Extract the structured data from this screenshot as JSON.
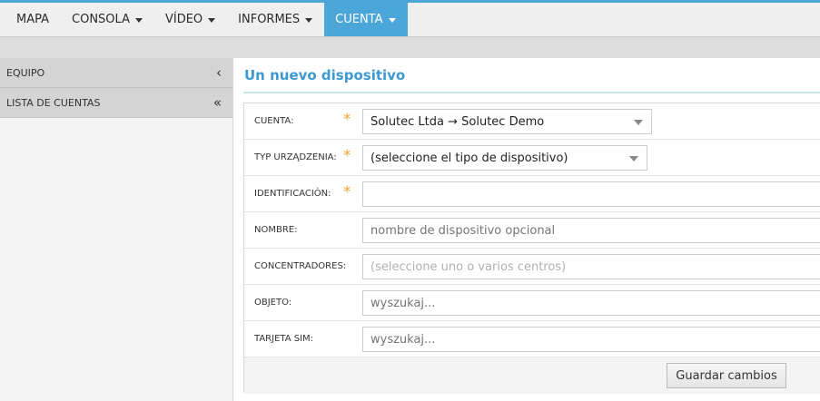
{
  "nav": {
    "items": [
      {
        "label": "MAPA"
      },
      {
        "label": "CONSOLA"
      },
      {
        "label": "VÍDEO"
      },
      {
        "label": "INFORMES"
      },
      {
        "label": "CUENTA"
      }
    ],
    "active": "CUENTA",
    "accent_color": "#4ba7d9"
  },
  "sidebar": {
    "items": [
      {
        "label": "EQUIPO",
        "icon": "chevron-left-icon"
      },
      {
        "label": "LISTA DE CUENTAS",
        "icon": "double-chevron-left-icon"
      }
    ]
  },
  "main": {
    "title": "Un nuevo dispositivo",
    "title_color": "#3d9ad0"
  },
  "form": {
    "account": {
      "label": "CUENTA:",
      "value": "Solutec Ltda → Solutec Demo",
      "required": true
    },
    "device_type": {
      "label": "TYP URZĄDZENIA:",
      "value": "(seleccione el tipo de dispositivo)",
      "required": true
    },
    "identification": {
      "label": "IDENTIFICACIÓN:",
      "value": "",
      "required": true
    },
    "name": {
      "label": "NOMBRE:",
      "placeholder": "nombre de dispositivo opcional"
    },
    "hubs": {
      "label": "CONCENTRADORES:",
      "placeholder": "(seleccione uno o varios centros)"
    },
    "object": {
      "label": "OBJETO:",
      "placeholder": "wyszukaj..."
    },
    "sim": {
      "label": "TARJETA SIM:",
      "placeholder": "wyszukaj..."
    },
    "required_mark": "*",
    "save_label": "Guardar cambios"
  }
}
